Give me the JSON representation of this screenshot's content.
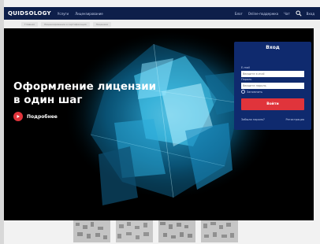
{
  "navbar": {
    "logo": "QUIDSOLOGY",
    "links": [
      "Услуги",
      "Лицензирование"
    ],
    "right": [
      "Блог",
      "Online-поддержка",
      "Чат",
      "Вход"
    ]
  },
  "breadcrumbs": [
    "Главная",
    "Лицензирование и сертификация",
    "Лицензии"
  ],
  "hero": {
    "title": "Оформление лицензии в один шаг",
    "cta_label": "Подробнее"
  },
  "login": {
    "title": "Вход",
    "email_label": "E-mail",
    "email_placeholder": "Введите e-mail",
    "password_label": "Пароль",
    "password_placeholder": "Введите пароль",
    "remember_label": "Запомнить",
    "submit_label": "Войти",
    "forgot_label": "Забыли пароль?",
    "register_label": "Регистрация"
  },
  "icons": {
    "search": "search-icon",
    "cta": "play-icon",
    "thumbnail": "pattern-icon"
  },
  "colors": {
    "navbar": "#0e1f4a",
    "panel": "#0f2a6e",
    "accent": "#e0343b",
    "crystal": "#3fd0ff"
  }
}
